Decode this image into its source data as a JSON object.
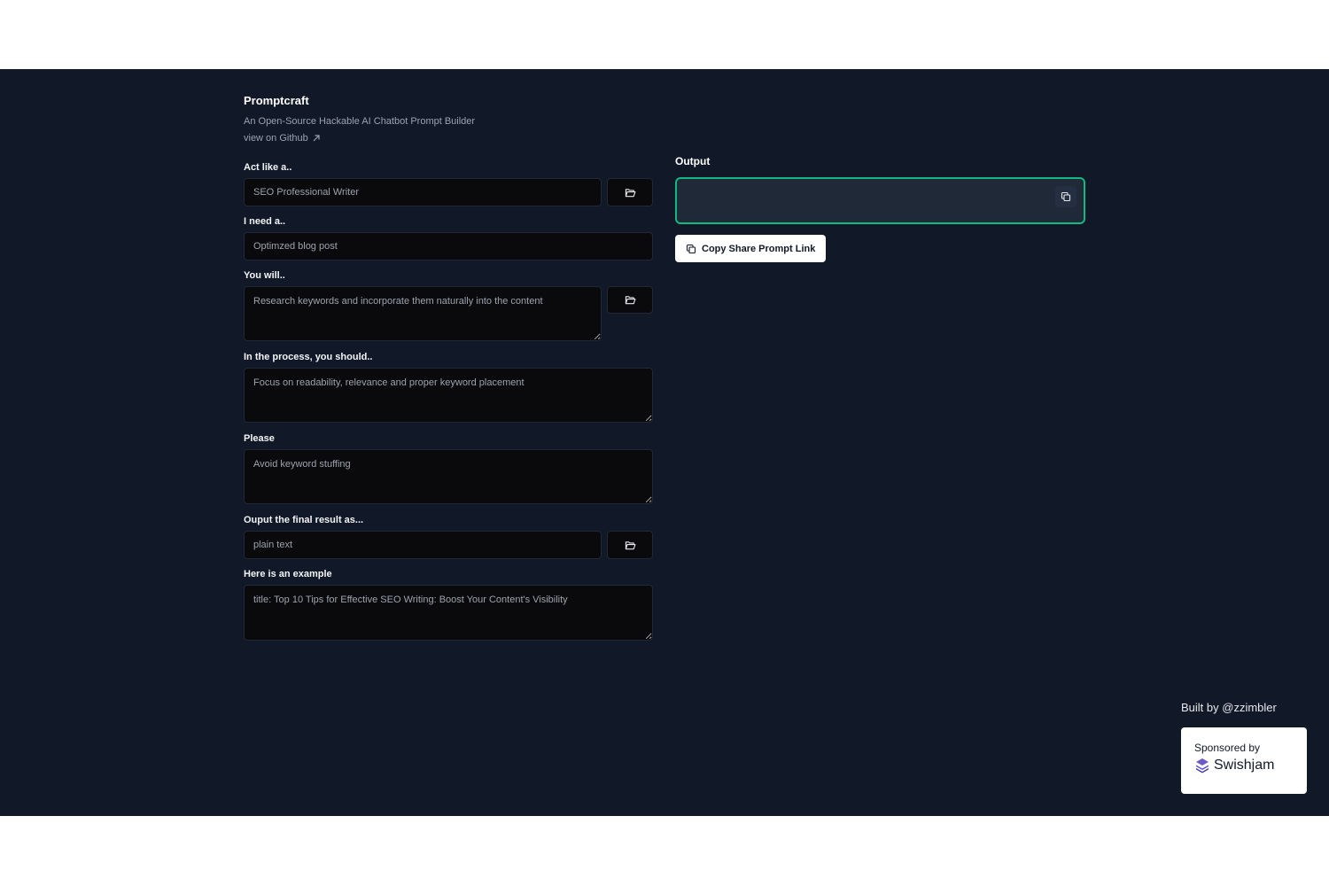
{
  "app": {
    "title": "Promptcraft",
    "subtitle": "An Open-Source Hackable AI Chatbot Prompt Builder",
    "github_link": "view on Github"
  },
  "form": {
    "act_like": {
      "label": "Act like a..",
      "placeholder": "SEO Professional Writer"
    },
    "i_need": {
      "label": "I need a..",
      "placeholder": "Optimzed blog post"
    },
    "you_will": {
      "label": "You will..",
      "placeholder": "Research keywords and incorporate them naturally into the content"
    },
    "in_process": {
      "label": "In the process, you should..",
      "placeholder": "Focus on readability, relevance and proper keyword placement"
    },
    "please": {
      "label": "Please",
      "placeholder": "Avoid keyword stuffing"
    },
    "output_as": {
      "label": "Ouput the final result as...",
      "placeholder": "plain text"
    },
    "example": {
      "label": "Here is an example",
      "placeholder": "title: Top 10 Tips for Effective SEO Writing: Boost Your Content's Visibility"
    }
  },
  "output": {
    "label": "Output",
    "value": "",
    "share_button": "Copy Share Prompt Link"
  },
  "footer": {
    "built_by": "Built by @zzimbler",
    "sponsored_by": "Sponsored by",
    "sponsor_name": "Swishjam"
  },
  "colors": {
    "background": "#111827",
    "input_background": "#0a0a0c",
    "output_border": "#10b981",
    "output_background": "#1f2937"
  },
  "icons": {
    "preset_button": "folder-open-icon",
    "copy": "copy-icon",
    "external_link": "arrow-up-right-icon",
    "sponsor_logo": "swishjam-logo-icon"
  }
}
